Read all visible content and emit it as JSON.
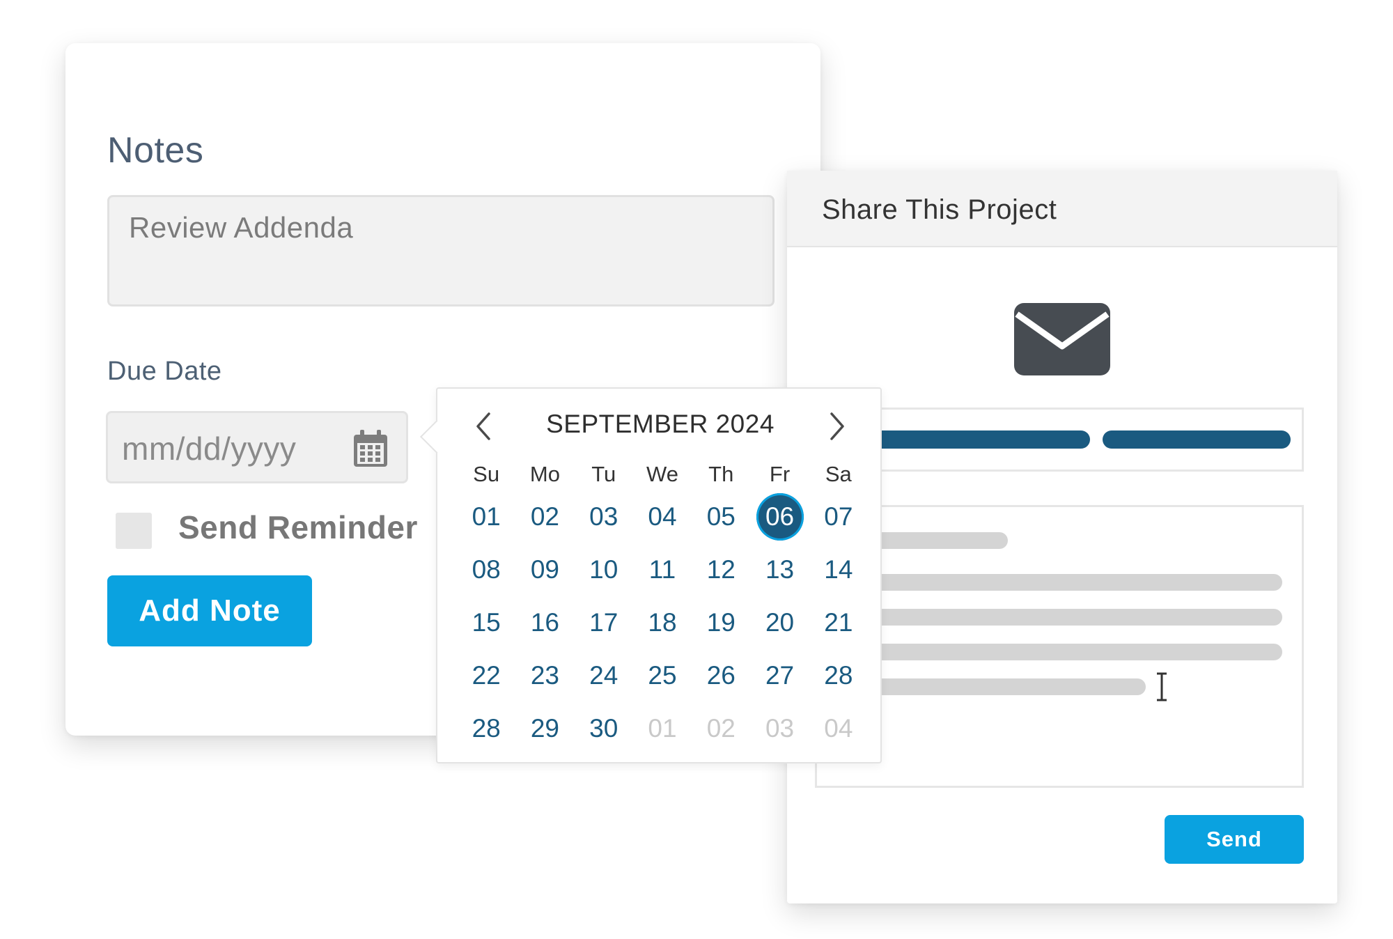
{
  "notes_panel": {
    "title": "Notes",
    "note_text": "Review Addenda",
    "due_date_label": "Due Date",
    "date_placeholder": "mm/dd/yyyy",
    "reminder_label": "Send Reminder",
    "add_note_label": "Add Note",
    "reminder_checked": false
  },
  "share_panel": {
    "title": "Share This Project",
    "send_label": "Send",
    "icon": "envelope-icon"
  },
  "datepicker": {
    "month_label": "SEPTEMBER 2024",
    "weekdays": [
      "Su",
      "Mo",
      "Tu",
      "We",
      "Th",
      "Fr",
      "Sa"
    ],
    "selected_day": "06",
    "weeks": [
      [
        "01",
        "02",
        "03",
        "04",
        "05",
        "06",
        "07"
      ],
      [
        "08",
        "09",
        "10",
        "11",
        "12",
        "13",
        "14"
      ],
      [
        "15",
        "16",
        "17",
        "18",
        "19",
        "20",
        "21"
      ],
      [
        "22",
        "23",
        "24",
        "25",
        "26",
        "27",
        "28"
      ],
      [
        "28",
        "29",
        "30",
        "01",
        "02",
        "03",
        "04"
      ]
    ],
    "outside_month": [
      [
        4,
        3
      ],
      [
        4,
        4
      ],
      [
        4,
        5
      ],
      [
        4,
        6
      ]
    ]
  },
  "colors": {
    "accent_blue": "#0aa2e0",
    "dark_blue": "#1a5a80",
    "envelope": "#474c52"
  }
}
